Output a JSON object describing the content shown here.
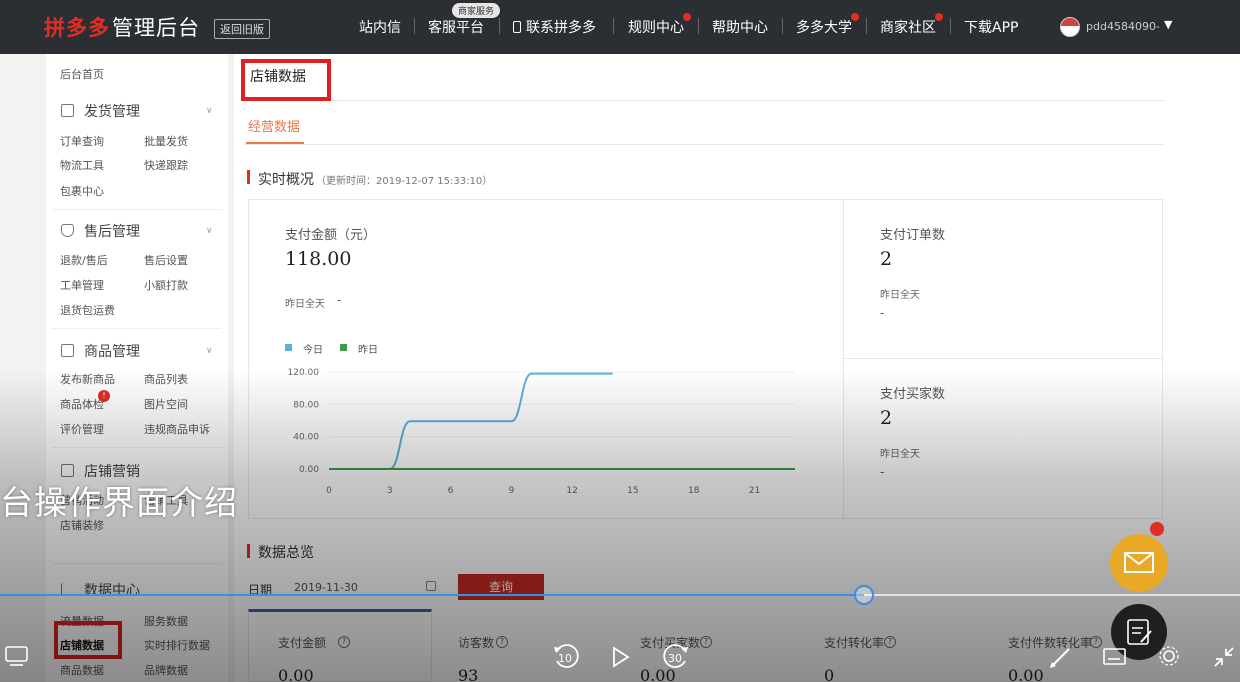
{
  "topbar": {
    "logo_main": "拼多多",
    "logo_sub": "管理后台",
    "logo_tag": "返回旧版",
    "badge": "商家服务",
    "nav": [
      "站内信",
      "客服平台",
      "联系拼多多",
      "规则中心",
      "帮助中心",
      "多多大学",
      "商家社区",
      "下载APP"
    ],
    "user_name": "pdd4584090-"
  },
  "sidebar": {
    "top_item": "后台首页",
    "sections": [
      {
        "title": "发货管理",
        "items": [
          "订单查询",
          "批量发货",
          "物流工具",
          "快递跟踪",
          "包裹中心"
        ]
      },
      {
        "title": "售后管理",
        "items": [
          "退款/售后",
          "售后设置",
          "工单管理",
          "小额打款",
          "退货包运费"
        ]
      },
      {
        "title": "商品管理",
        "items": [
          "发布新商品",
          "商品列表",
          "商品体检",
          "图片空间",
          "评价管理",
          "违规商品申诉"
        ]
      },
      {
        "title": "店铺营销",
        "items": [
          "营销活动",
          "营销工具",
          "店铺装修"
        ]
      },
      {
        "title": "数据中心",
        "items": [
          "流量数据",
          "服务数据",
          "店铺数据",
          "实时排行数据",
          "商品数据",
          "品牌数据"
        ]
      }
    ]
  },
  "main": {
    "page_title": "店铺数据",
    "tab": "经营数据",
    "realtime": {
      "title": "实时概况",
      "time": "（更新时间：2019-12-07 15:33:10）",
      "pay_amount_label": "支付金额（元）",
      "pay_amount_value": "118.00",
      "yesterday_label": "昨日全天",
      "yesterday_value": "-",
      "legend_today": "今日",
      "legend_yesterday": "昨日",
      "pay_orders_label": "支付订单数",
      "pay_orders_value": "2",
      "pay_orders_yest_label": "昨日全天",
      "pay_orders_yest_value": "-",
      "pay_buyers_label": "支付买家数",
      "pay_buyers_value": "2",
      "pay_buyers_yest_label": "昨日全天",
      "pay_buyers_yest_value": "-"
    },
    "summary": {
      "title": "数据总览",
      "date_label": "日期",
      "date_value": "2019-11-30",
      "button": "查询",
      "cards": [
        "支付金额",
        "访客数",
        "支付买家数",
        "支付转化率",
        "支付件数转化率"
      ],
      "card_values": [
        "0.00",
        "93",
        "0.00",
        "0",
        "0.00"
      ]
    }
  },
  "chart_data": {
    "type": "line",
    "x": [
      0,
      3,
      6,
      9,
      12,
      15,
      18,
      21
    ],
    "xtick_labels": [
      "0",
      "3",
      "6",
      "9",
      "12",
      "15",
      "18",
      "21"
    ],
    "ytick_labels": [
      "0.00",
      "40.00",
      "80.00",
      "120.00"
    ],
    "ylim": [
      0,
      120
    ],
    "xlim": [
      0,
      23
    ],
    "series": [
      {
        "name": "今日",
        "color": "#5ab4d9",
        "x": [
          0,
          3,
          4,
          6,
          8,
          9,
          10,
          14
        ],
        "values": [
          0,
          0,
          59,
          59,
          59,
          59,
          118,
          118
        ]
      },
      {
        "name": "昨日",
        "color": "#3a9c49",
        "x": [
          0,
          23
        ],
        "values": [
          0,
          0
        ]
      }
    ]
  },
  "overlay": {
    "caption": "台操作界面介绍",
    "progress_fraction": 0.697,
    "rewind_label": "10",
    "forward_label": "30"
  }
}
